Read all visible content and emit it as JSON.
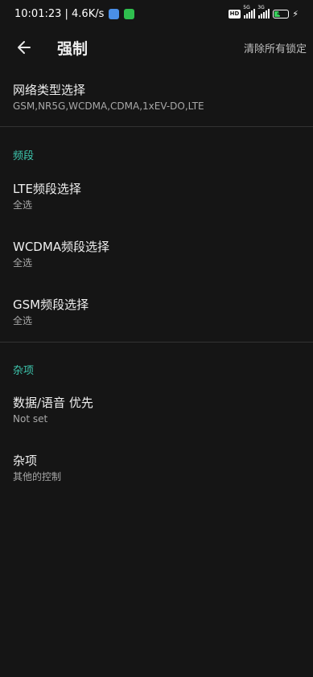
{
  "status_bar": {
    "time_speed": "10:01:23 | 4.6K/s",
    "hd": "HD",
    "sim1_net": "5G",
    "sim2_net": "3G",
    "battery": "41"
  },
  "header": {
    "title": "强制",
    "action": "清除所有锁定"
  },
  "items": {
    "network_type": {
      "title": "网络类型选择",
      "summary": "GSM,NR5G,WCDMA,CDMA,1xEV-DO,LTE"
    },
    "lte_band": {
      "title": "LTE频段选择",
      "summary": "全选"
    },
    "wcdma_band": {
      "title": "WCDMA频段选择",
      "summary": "全选"
    },
    "gsm_band": {
      "title": "GSM频段选择",
      "summary": "全选"
    },
    "data_voice": {
      "title": "数据/语音 优先",
      "summary": "Not set"
    },
    "misc": {
      "title": "杂项",
      "summary": "其他的控制"
    }
  },
  "categories": {
    "bands": "频段",
    "misc": "杂项"
  },
  "colors": {
    "accent": "#3ec9b0",
    "background": "#151515"
  }
}
